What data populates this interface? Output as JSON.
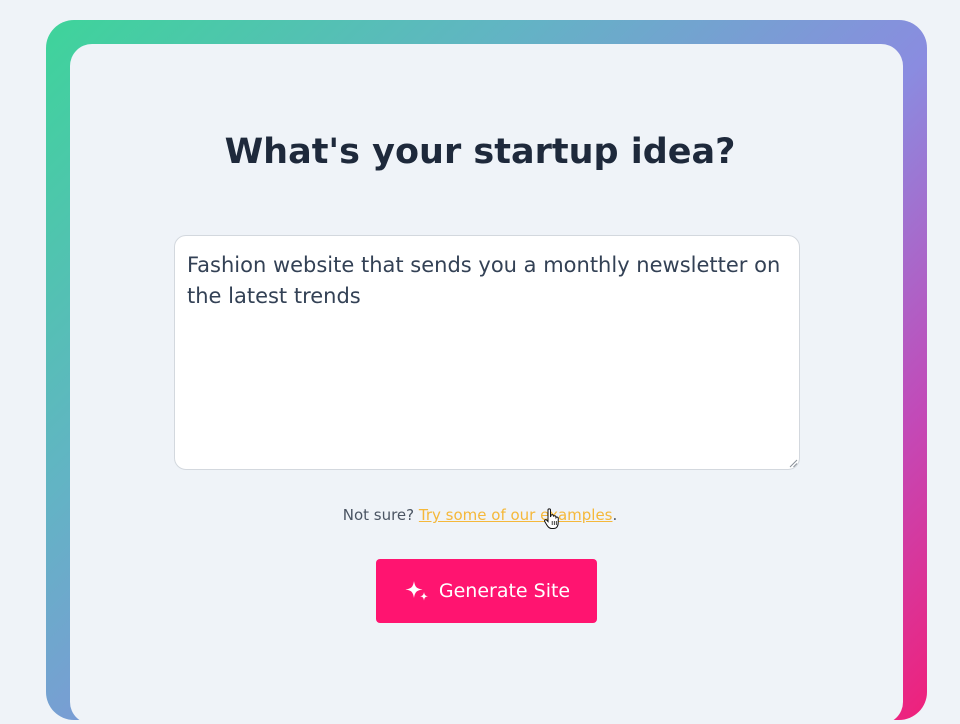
{
  "form": {
    "heading": "What's your startup idea?",
    "idea_value": "Fashion website that sends you a monthly newsletter on the latest trends",
    "hint_prefix": "Not sure? ",
    "hint_link": "Try some of our examples",
    "hint_suffix": ".",
    "submit_label": "Generate Site"
  },
  "colors": {
    "accent": "#ff1470",
    "link": "#f5b83a",
    "heading": "#1e293b",
    "gradient_start": "#3ed49a",
    "gradient_mid": "#8a8ce0",
    "gradient_end": "#f0207a"
  },
  "icons": {
    "submit": "sparkles-icon",
    "cursor": "hand-pointer-icon"
  }
}
